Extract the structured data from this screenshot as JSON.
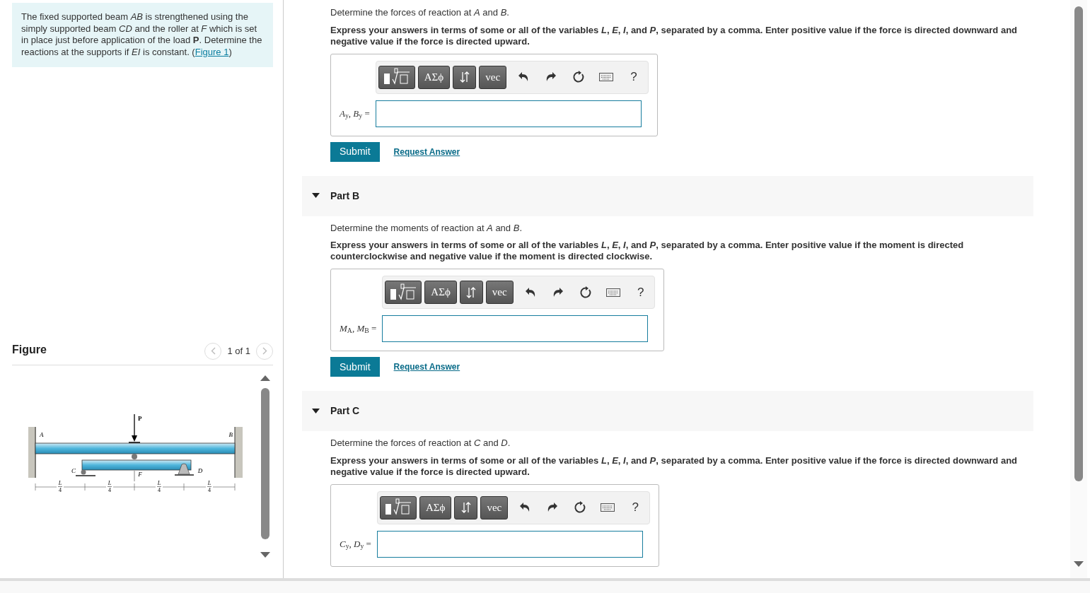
{
  "intro": {
    "text": "The fixed supported beam *AB* is strengthened using the simply supported beam *CD* and the roller at *F* which is set in place just before application of the load **P**. Determine the reactions at the supports if *EI* is constant. (",
    "link": "Figure 1",
    "after": ")"
  },
  "figure_panel": {
    "title": "Figure",
    "pager": "1 of 1",
    "prev_disabled": true,
    "next_disabled": true,
    "figure": {
      "load_label": "P",
      "point_labels": [
        "A",
        "B",
        "C",
        "D",
        "F"
      ],
      "dimension_labels": [
        {
          "num": "L",
          "den": "4"
        },
        {
          "num": "L",
          "den": "4"
        },
        {
          "num": "L",
          "den": "4"
        },
        {
          "num": "L",
          "den": "4"
        }
      ]
    }
  },
  "parts": [
    {
      "prompt": "Determine the forces of reaction at *A* and *B*.",
      "instruction": "Express your answers in terms of some or all of the variables *L*, *E*, *I*, and *P*, separated by a comma. Enter positive value if the force is directed downward and negative value if the force is directed upward.",
      "toolbar": [
        {
          "kind": "templates"
        },
        {
          "kind": "text",
          "label": "ΑΣϕ"
        },
        {
          "kind": "arrows"
        },
        {
          "kind": "text",
          "label": "vec"
        },
        {
          "kind": "undo"
        },
        {
          "kind": "redo"
        },
        {
          "kind": "reset"
        },
        {
          "kind": "keyboard"
        },
        {
          "kind": "help",
          "label": "?"
        }
      ],
      "answer_label": "*A*$_{y}$, *B*$_{y}$ =",
      "submit": "Submit",
      "request": "Request Answer"
    },
    {
      "title": "Part B",
      "expanded": true,
      "prompt": "Determine the moments of reaction at *A* and *B*.",
      "instruction": "Express your answers in terms of some or all of the variables *L*, *E*, *I*, and *P*, separated by a comma. Enter positive value if the moment is directed counterclockwise and negative value if the moment is directed clockwise.",
      "toolbar": [
        {
          "kind": "templates"
        },
        {
          "kind": "text",
          "label": "ΑΣϕ"
        },
        {
          "kind": "arrows"
        },
        {
          "kind": "text",
          "label": "vec"
        },
        {
          "kind": "undo"
        },
        {
          "kind": "redo"
        },
        {
          "kind": "reset"
        },
        {
          "kind": "keyboard"
        },
        {
          "kind": "help",
          "label": "?"
        }
      ],
      "answer_label": "*M*$_{A}$, *M*$_{B}$ =",
      "submit": "Submit",
      "request": "Request Answer"
    },
    {
      "title": "Part C",
      "expanded": true,
      "prompt": "Determine the forces of reaction at *C* and *D*.",
      "instruction": "Express your answers in terms of some or all of the variables *L*, *E*, *I*, and *P*, separated by a comma. Enter positive value if the force is directed downward and negative value if the force is directed upward.",
      "toolbar": [
        {
          "kind": "templates"
        },
        {
          "kind": "text",
          "label": "ΑΣϕ"
        },
        {
          "kind": "arrows"
        },
        {
          "kind": "text",
          "label": "vec"
        },
        {
          "kind": "undo"
        },
        {
          "kind": "redo"
        },
        {
          "kind": "reset"
        },
        {
          "kind": "keyboard"
        },
        {
          "kind": "help",
          "label": "?"
        }
      ],
      "answer_label": "*C*$_{y}$, *D*$_{y}$ ="
    }
  ]
}
